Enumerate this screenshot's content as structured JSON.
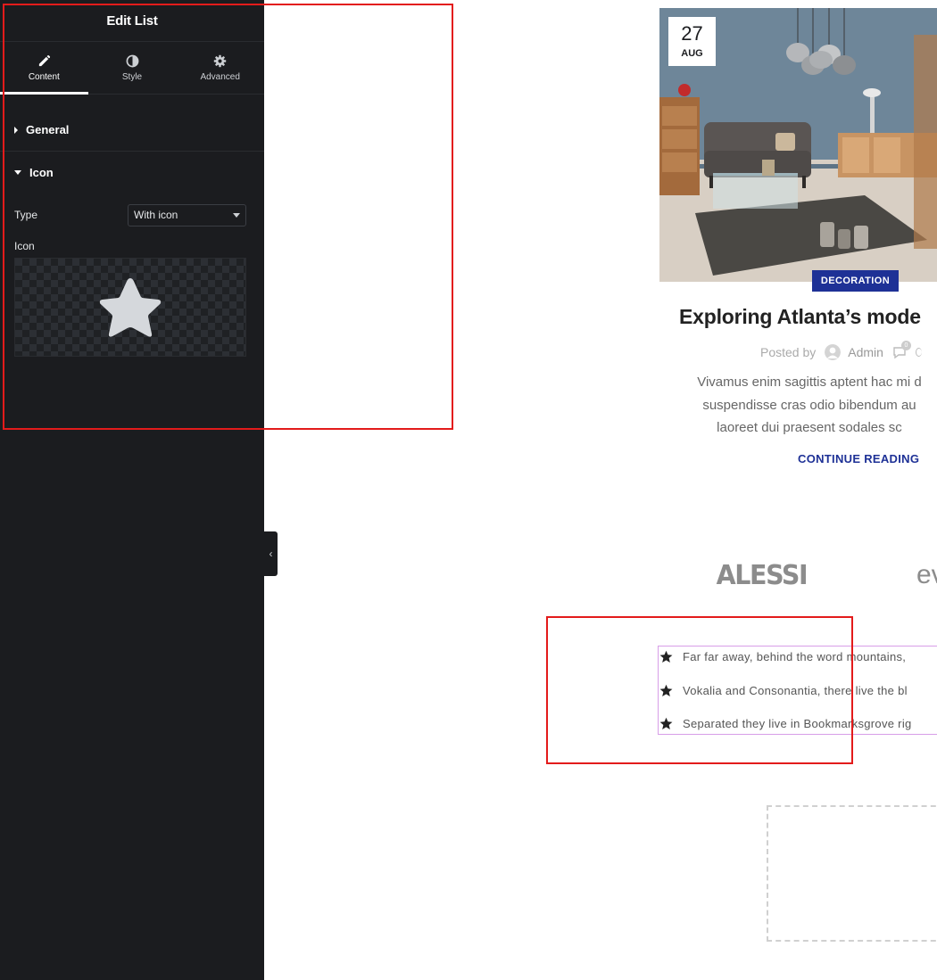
{
  "panel": {
    "title": "Edit List",
    "tabs": [
      {
        "label": "Content",
        "icon": "pencil-icon",
        "active": true
      },
      {
        "label": "Style",
        "icon": "contrast-icon",
        "active": false
      },
      {
        "label": "Advanced",
        "icon": "gear-icon",
        "active": false
      }
    ],
    "sections": {
      "general": {
        "label": "General",
        "expanded": false
      },
      "icon": {
        "label": "Icon",
        "expanded": true
      }
    },
    "type_label": "Type",
    "type_value": "With icon",
    "icon_label": "Icon",
    "selected_icon": "star-icon"
  },
  "post": {
    "date_day": "27",
    "date_month": "AUG",
    "category": "DECORATION",
    "title": "Exploring Atlanta’s mode",
    "meta_prefix": "Posted by",
    "author": "Admin",
    "comment_count": "0",
    "excerpt_lines": [
      "Vivamus enim sagittis aptent hac mi d",
      "suspendisse cras odio bibendum au",
      "laoreet dui praesent sodales sc"
    ],
    "continue_label": "CONTINUE READING"
  },
  "logos": {
    "first": "ALESSI",
    "second": "ev"
  },
  "icon_list": {
    "items": [
      "Far far away, behind the word mountains,",
      "Vokalia and Consonantia, there live the bl",
      "Separated they live in Bookmarksgrove rig"
    ]
  },
  "colors": {
    "panel_bg": "#1b1c1f",
    "accent_blue": "#1e3196",
    "annotation_red": "#e31b1b",
    "selection_outline": "#d89ee8"
  }
}
